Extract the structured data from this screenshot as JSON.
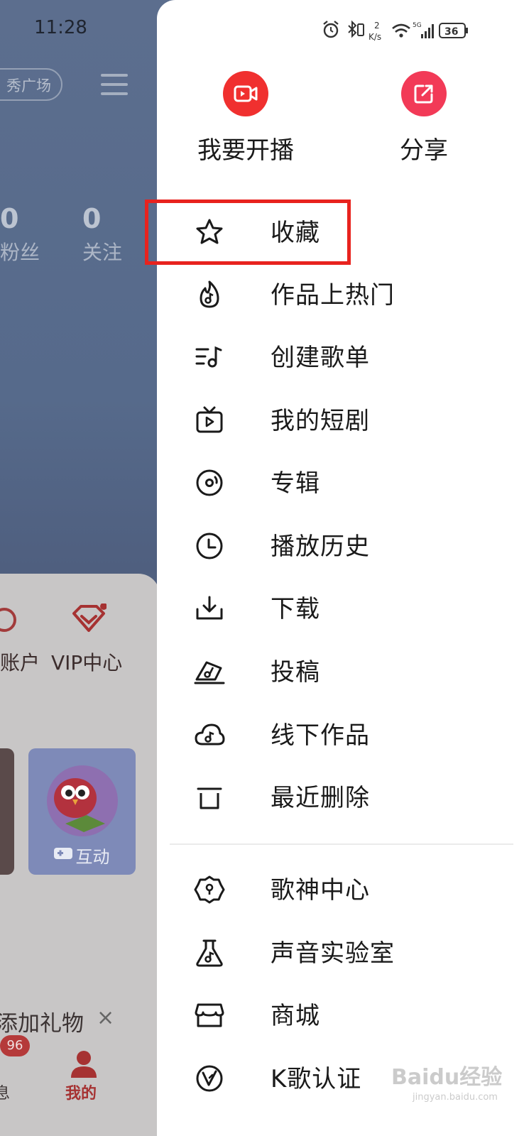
{
  "background_app": {
    "time": "11:28",
    "pill_label": "秀广场",
    "stats": [
      {
        "num": "0",
        "label": "粉丝"
      },
      {
        "num": "0",
        "label": "关注"
      }
    ],
    "account_label": "账户",
    "vip_label": "VIP中心",
    "interactive_tile_label": "互动",
    "gift_bar_text": "添加礼物",
    "gift_close": "×",
    "messages_badge": "96",
    "tab_messages_partial": "息",
    "tab_mine": "我的"
  },
  "status_bar": {
    "net_speed": "2",
    "net_unit": "K/s",
    "network": "5G",
    "battery": "36"
  },
  "drawer": {
    "top_actions": [
      {
        "label": "我要开播",
        "icon": "live-camera-icon",
        "color": "#f0302f"
      },
      {
        "label": "分享",
        "icon": "share-icon",
        "color": "#f23a57"
      }
    ],
    "menu": [
      {
        "label": "收藏",
        "icon": "star-icon"
      },
      {
        "label": "作品上热门",
        "icon": "flame-music-icon"
      },
      {
        "label": "创建歌单",
        "icon": "playlist-icon"
      },
      {
        "label": "我的短剧",
        "icon": "tv-play-icon"
      },
      {
        "label": "专辑",
        "icon": "disc-icon"
      },
      {
        "label": "播放历史",
        "icon": "clock-icon"
      },
      {
        "label": "下载",
        "icon": "download-icon"
      },
      {
        "label": "投稿",
        "icon": "submission-icon"
      },
      {
        "label": "线下作品",
        "icon": "cloud-music-icon"
      },
      {
        "label": "最近删除",
        "icon": "trash-icon"
      }
    ],
    "menu2": [
      {
        "label": "歌神中心",
        "icon": "badge-gear-icon"
      },
      {
        "label": "声音实验室",
        "icon": "flask-icon"
      },
      {
        "label": "商城",
        "icon": "store-icon"
      },
      {
        "label": "K歌认证",
        "icon": "verified-v-icon"
      }
    ]
  },
  "watermark": {
    "text": "Baidu经验",
    "sub": "jingyan.baidu.com"
  },
  "colors": {
    "accent_red": "#e8231e",
    "live_red": "#f0302f",
    "share_pink": "#f23a57"
  }
}
